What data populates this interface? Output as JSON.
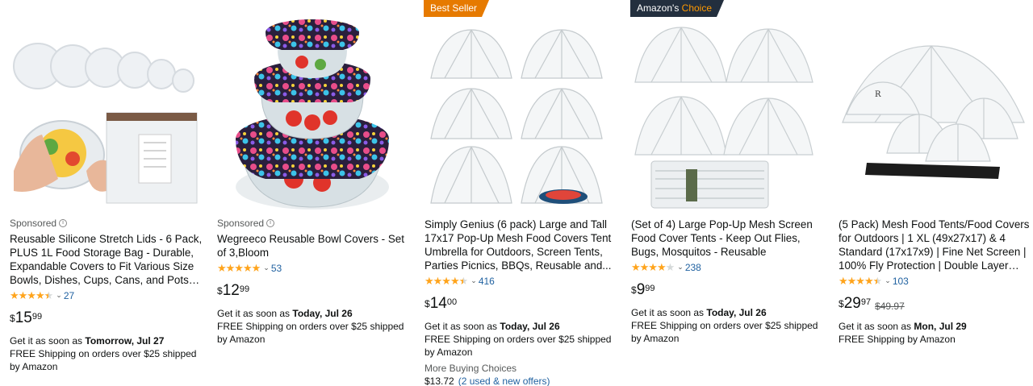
{
  "products": [
    {
      "sponsored_label": "Sponsored",
      "title": "Reusable Silicone Stretch Lids - 6 Pack, PLUS 1L Food Storage Bag - Durable, Expandable Covers to Fit Various Size Bowls, Dishes, Cups, Cans, and Pots -...",
      "rating": 4.8,
      "review_count": "27",
      "price_symbol": "$",
      "price_whole": "15",
      "price_fraction": "99",
      "delivery_prefix": "Get it as soon as ",
      "delivery_date": "Tomorrow, Jul 27",
      "shipping": "FREE Shipping on orders over $25 shipped by Amazon"
    },
    {
      "sponsored_label": "Sponsored",
      "title": "Wegreeco Reusable Bowl Covers - Set of 3,Bloom",
      "rating": 4.9,
      "review_count": "53",
      "price_symbol": "$",
      "price_whole": "12",
      "price_fraction": "99",
      "delivery_prefix": "Get it as soon as ",
      "delivery_date": "Today, Jul 26",
      "shipping": "FREE Shipping on orders over $25 shipped by Amazon"
    },
    {
      "badge": "Best Seller",
      "title": "Simply Genius (6 pack) Large and Tall 17x17 Pop-Up Mesh Food Covers Tent Umbrella for Outdoors, Screen Tents, Parties Picnics, BBQs, Reusable and...",
      "rating": 4.5,
      "review_count": "416",
      "price_symbol": "$",
      "price_whole": "14",
      "price_fraction": "00",
      "delivery_prefix": "Get it as soon as ",
      "delivery_date": "Today, Jul 26",
      "shipping": "FREE Shipping on orders over $25 shipped by Amazon",
      "more_buying_label": "More Buying Choices",
      "more_buying_price": "$13.72",
      "more_buying_offers": "(2 used & new offers)"
    },
    {
      "badge_prefix": "Amazon's",
      "badge_highlight": "Choice",
      "title": "(Set of 4) Large Pop-Up Mesh Screen Food Cover Tents - Keep Out Flies, Bugs, Mosquitos - Reusable",
      "rating": 4.3,
      "review_count": "238",
      "price_symbol": "$",
      "price_whole": "9",
      "price_fraction": "99",
      "delivery_prefix": "Get it as soon as ",
      "delivery_date": "Today, Jul 26",
      "shipping": "FREE Shipping on orders over $25 shipped by Amazon"
    },
    {
      "title": "(5 Pack) Mesh Food Tents/Food Covers for Outdoors | 1 XL (49x27x17) & 4 Standard (17x17x9) | Fine Net Screen | 100% Fly Protection | Double Layer Skir...",
      "rating": 4.5,
      "review_count": "103",
      "price_symbol": "$",
      "price_whole": "29",
      "price_fraction": "97",
      "list_price": "$49.97",
      "delivery_prefix": "Get it as soon as ",
      "delivery_date": "Mon, Jul 29",
      "shipping": "FREE Shipping by Amazon"
    }
  ],
  "colors": {
    "star": "#ffa41c",
    "link": "#2162a1",
    "best_seller_badge": "#e67a00",
    "choice_badge": "#232f3e",
    "choice_highlight": "#ff9900"
  },
  "icons": {
    "info": "info-circle-icon",
    "chevron": "chevron-down-icon",
    "star": "star-icon"
  }
}
